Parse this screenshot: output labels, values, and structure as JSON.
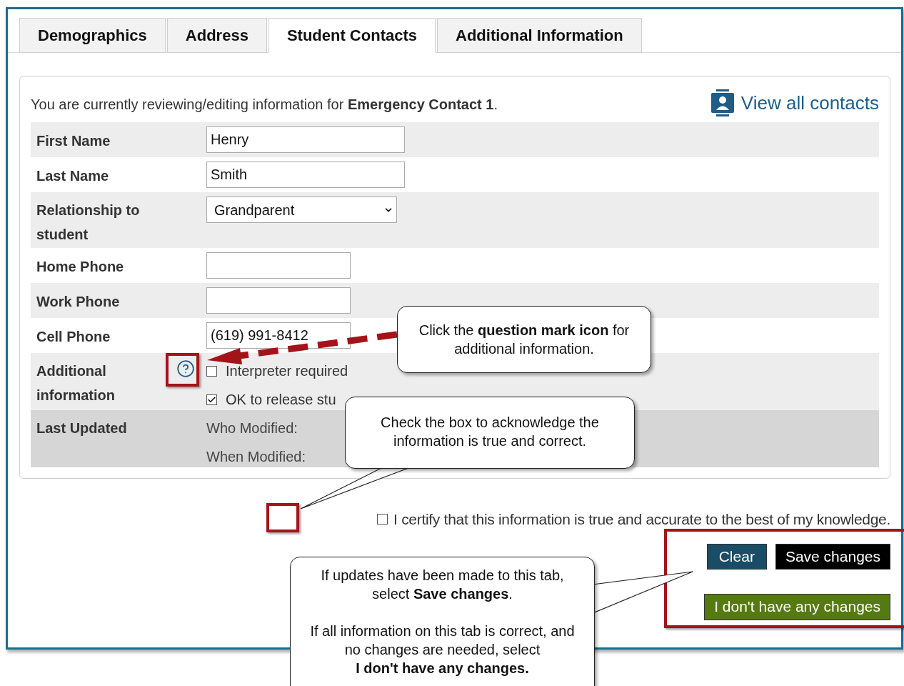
{
  "tabs": [
    {
      "label": "Demographics",
      "selected": false
    },
    {
      "label": "Address",
      "selected": false
    },
    {
      "label": "Student Contacts",
      "selected": true
    },
    {
      "label": "Additional Information",
      "selected": false
    }
  ],
  "intro": "You are currently reviewing/editing information for **Emergency Contact 1**.",
  "view_all_contacts": "View all contacts",
  "fields": [
    {
      "kind": "text",
      "label": "First Name",
      "value": "Henry"
    },
    {
      "kind": "text",
      "label": "Last Name",
      "value": "Smith"
    },
    {
      "kind": "select",
      "label": "Relationship to student",
      "value": "Grandparent"
    },
    {
      "kind": "short_text",
      "label": "Home Phone"
    },
    {
      "kind": "short_text",
      "label": "Work Phone"
    },
    {
      "kind": "short_text",
      "label": "Cell Phone",
      "value": "(619) 991-8412"
    },
    {
      "kind": "checkboxes",
      "label": "Additional information",
      "options": [
        {
          "label": "Interpreter required",
          "checked": false
        },
        {
          "label": "OK to release stu",
          "checked": true
        }
      ]
    },
    {
      "kind": "info",
      "label": "Last Updated",
      "lines": [
        "Who Modified:",
        "When Modified:"
      ]
    }
  ],
  "certify": {
    "label": "I certify that this information is true and accurate to the best of my knowledge.",
    "checked": false
  },
  "buttons": [
    {
      "kind": "clear",
      "label": "Clear"
    },
    {
      "kind": "save",
      "label": "Save changes"
    },
    {
      "kind": "no_changes",
      "label": "I don't have any changes"
    }
  ],
  "callouts": [
    {
      "text": "Click the **question mark icon** for additional information."
    },
    {
      "text": "Check the box to acknowledge the information is true and correct."
    },
    {
      "text": "If updates have been made to this tab, select **Save changes**.\n\nIf all information on this tab is correct, and no changes are needed, select\n**I don't have any changes.**"
    }
  ]
}
